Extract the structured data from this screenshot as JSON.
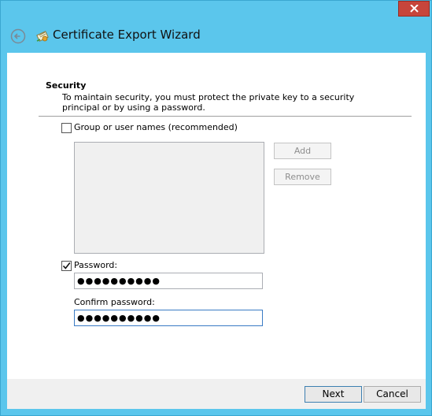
{
  "window": {
    "title": "Certificate Export Wizard",
    "accent_color": "#5bc6ec",
    "close_color": "#c7453b",
    "icons": {
      "close": "close-icon",
      "back": "back-arrow-icon",
      "wizard": "certificate-icon"
    }
  },
  "security": {
    "title": "Security",
    "description": "To maintain security, you must protect the private key to a security principal or by using a password."
  },
  "group": {
    "checkbox_label": "Group or user names (recommended)",
    "checked": false,
    "add_label": "Add",
    "remove_label": "Remove"
  },
  "password": {
    "checkbox_label": "Password:",
    "checked": true,
    "value": "●●●●●●●●●●",
    "confirm_label": "Confirm password:",
    "confirm_value": "●●●●●●●●●●"
  },
  "footer": {
    "next_label": "Next",
    "cancel_label": "Cancel"
  }
}
